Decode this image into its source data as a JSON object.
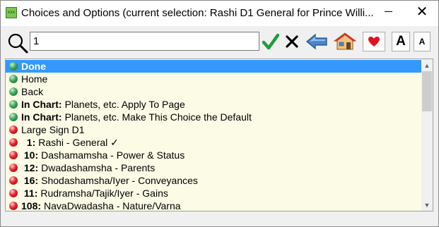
{
  "window": {
    "title": "Choices and Options (current selection: Rashi D1 General for Prince Willi...",
    "app_icon_text": "xxx",
    "minimize_glyph": "—",
    "close_glyph": "✕"
  },
  "toolbar": {
    "search_value": "1",
    "icons": {
      "search": "magnifier-icon",
      "accept": "green-checkmark-icon",
      "clear": "black-x-icon",
      "back": "back-arrow-icon",
      "home": "house-icon",
      "favorite": "red-heart-icon"
    },
    "font_larger_label": "A",
    "font_smaller_label": "A"
  },
  "list": {
    "items": [
      {
        "prefix": "",
        "label": "Done",
        "dot": "green",
        "selected": true
      },
      {
        "prefix": "",
        "label": "Home",
        "dot": "green",
        "selected": false
      },
      {
        "prefix": "",
        "label": "Back",
        "dot": "green",
        "selected": false
      },
      {
        "prefix": "In Chart:",
        "label": "Planets, etc. Apply To Page",
        "dot": "green",
        "selected": false
      },
      {
        "prefix": "In Chart:",
        "label": "Planets, etc. Make This Choice the Default",
        "dot": "green",
        "selected": false
      },
      {
        "prefix": "",
        "label": "Large Sign D1",
        "dot": "red",
        "selected": false
      },
      {
        "prefix": "  1:",
        "label": "Rashi - General ✓",
        "dot": "red",
        "selected": false
      },
      {
        "prefix": " 10:",
        "label": "Dashamamsha - Power & Status",
        "dot": "red",
        "selected": false
      },
      {
        "prefix": " 12:",
        "label": "Dwadashamsha - Parents",
        "dot": "red",
        "selected": false
      },
      {
        "prefix": " 16:",
        "label": "Shodashamsha/Iyer - Conveyances",
        "dot": "red",
        "selected": false
      },
      {
        "prefix": " 11:",
        "label": "Rudramsha/Tajik/Iyer - Gains",
        "dot": "red",
        "selected": false
      },
      {
        "prefix": "108:",
        "label": "NavaDwadasha - Nature/Varna",
        "dot": "red",
        "selected": false
      }
    ]
  },
  "colors": {
    "selection": "#3399ff",
    "row_background": "#fbfbe6"
  }
}
